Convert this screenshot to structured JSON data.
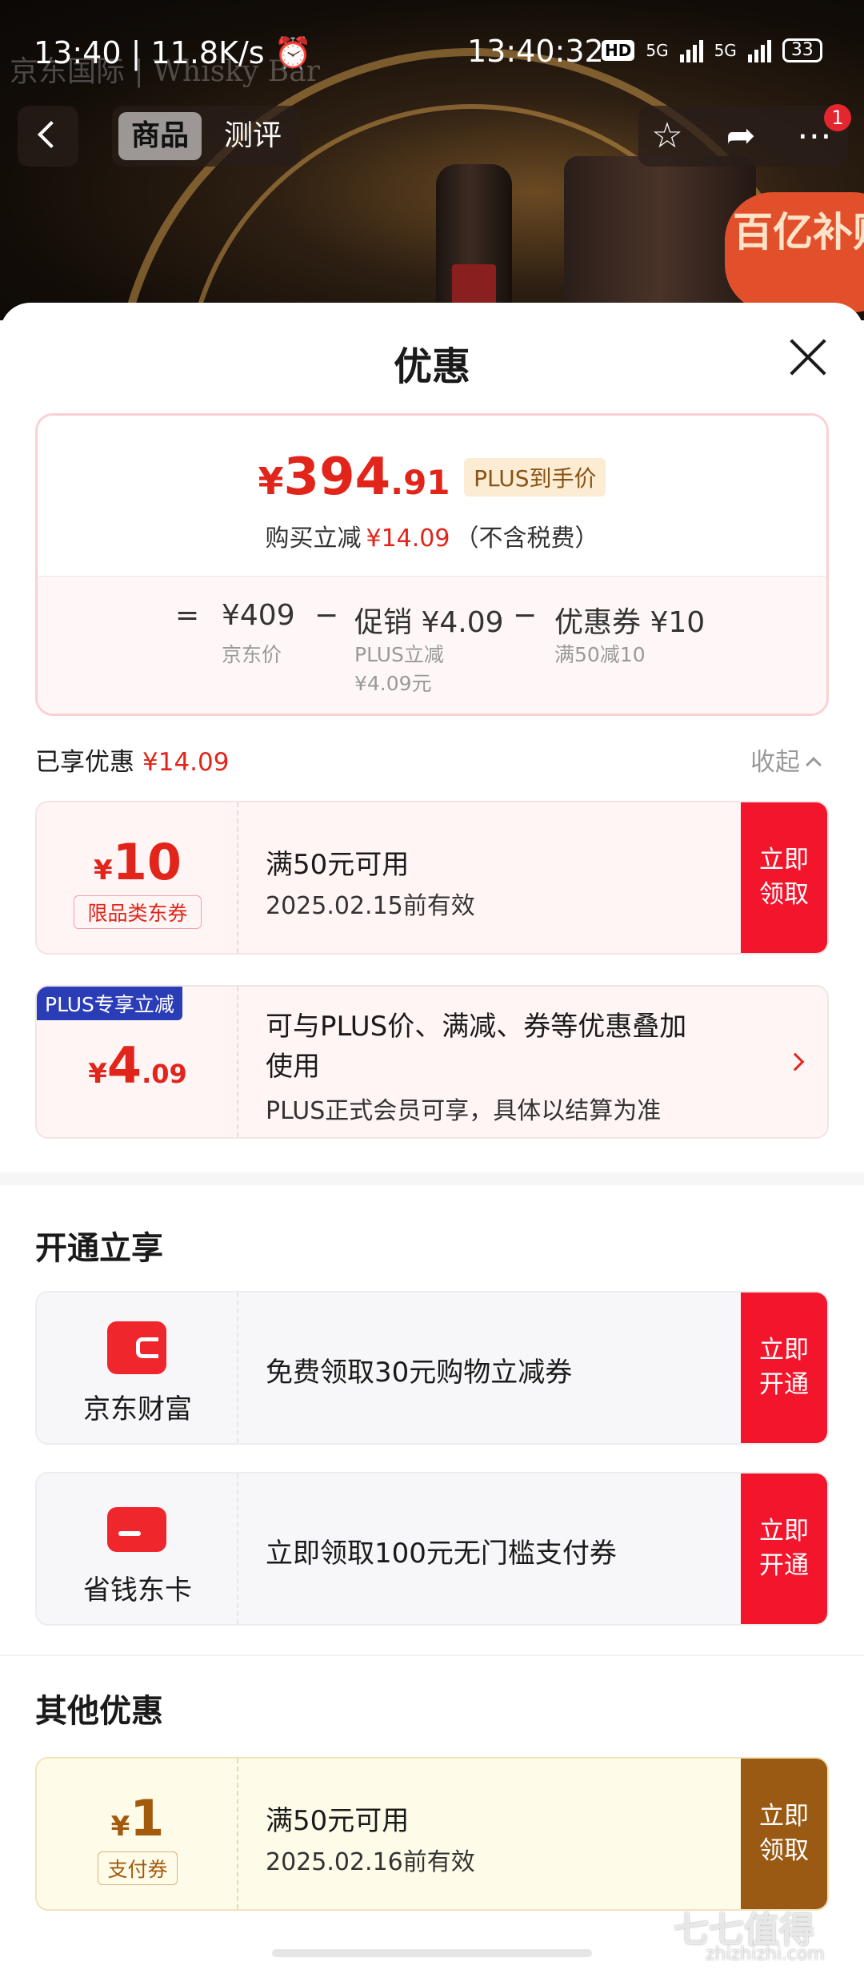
{
  "status_bar": {
    "left": "13:40 | 11.8K/s ⏰",
    "clock": "13:40:32",
    "hd": "HD",
    "net1": "5G",
    "net2": "5G",
    "battery": "33"
  },
  "header": {
    "watermark": "京东国际 | Whisky Bar",
    "tabs": [
      "商品",
      "测评"
    ],
    "badge_count": "1",
    "subsidy_label": "百亿补贴"
  },
  "sheet": {
    "title": "优惠",
    "price": {
      "yen": "¥",
      "integer": "394",
      "decimal": ".91",
      "plus_tag": "PLUS到手价",
      "reduce_prefix": "购买立减",
      "reduce_amount": "¥14.09",
      "reduce_suffix": "（不含税费）"
    },
    "breakdown": {
      "equals": "=",
      "jd_price": "¥409",
      "jd_price_label": "京东价",
      "minus": "−",
      "promo": "促销 ¥4.09",
      "promo_sub1": "PLUS立减",
      "promo_sub2": "¥4.09元",
      "coupon": "优惠券 ¥10",
      "coupon_sub": "满50减10"
    },
    "enjoyed_label": "已享优惠",
    "enjoyed_amount": "¥14.09",
    "collapse_label": "收起",
    "coupons": [
      {
        "yen": "¥",
        "amount": "10",
        "tag": "限品类东券",
        "line1": "满50元可用",
        "line2": "2025.02.15前有效",
        "cta": "立即领取"
      },
      {
        "ribbon": "PLUS专享立减",
        "yen": "¥",
        "amount": "4",
        "decimal": ".09",
        "line1": "可与PLUS价、满减、券等优惠叠加",
        "line1b": "使用",
        "line2": "PLUS正式会员可享，具体以结算为准"
      }
    ],
    "open_section_title": "开通立享",
    "services": [
      {
        "name": "京东财富",
        "text": "免费领取30元购物立减券",
        "cta": "立即开通"
      },
      {
        "name": "省钱东卡",
        "text": "立即领取100元无门槛支付券",
        "cta": "立即开通"
      }
    ],
    "other_section_title": "其他优惠",
    "other_coupon": {
      "yen": "¥",
      "amount": "1",
      "tag": "支付券",
      "line1": "满50元可用",
      "line2": "2025.02.16前有效",
      "cta": "立即领取"
    }
  },
  "watermark": {
    "text": "七七值得",
    "url": "zhizhizhi.com"
  },
  "colors": {
    "accent_red": "#e1251b",
    "cta_red": "#f3152c",
    "gold": "#9b5a13",
    "plus_blue": "#2a3db7"
  }
}
